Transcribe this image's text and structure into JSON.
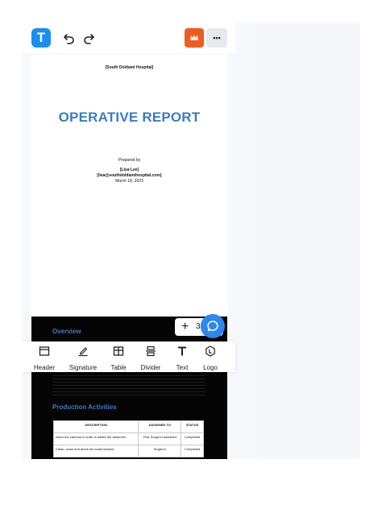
{
  "toolbar": {
    "logo_letter": "T",
    "more_label": "•••"
  },
  "document": {
    "hospital": "[South Doldami Hospital]",
    "title": "OPERATIVE REPORT",
    "prepared_by": "Prepared by",
    "author_name": "[Lisa Lee]",
    "author_email": "[lisa@southdoldamihospital.com]",
    "date": "March 18, 2023",
    "overview_heading": "Overview",
    "production_heading": "Production Activities",
    "table": {
      "headers": [
        "DESCRIPTION",
        "ASSIGNED TO",
        "STATUS"
      ],
      "rows": [
        [
          "Insert the cannula in order to inflate the abdomen",
          "First Surgeon Assistant",
          "Completed"
        ],
        [
          "Clean, close and dress the small incision",
          "Surgeon",
          "Completed"
        ]
      ]
    }
  },
  "insert_count": "3",
  "bottom_tools": [
    {
      "label": "Header",
      "icon": "header-icon"
    },
    {
      "label": "Signature",
      "icon": "signature-icon"
    },
    {
      "label": "Table",
      "icon": "table-icon"
    },
    {
      "label": "Divider",
      "icon": "divider-icon"
    },
    {
      "label": "Text",
      "icon": "text-icon"
    },
    {
      "label": "Logo",
      "icon": "logo-icon"
    }
  ],
  "colors": {
    "accent_blue": "#1d8df2",
    "crown_orange": "#f05b22",
    "title_blue": "#3b7cc4",
    "chat_blue": "#2f86ef"
  }
}
